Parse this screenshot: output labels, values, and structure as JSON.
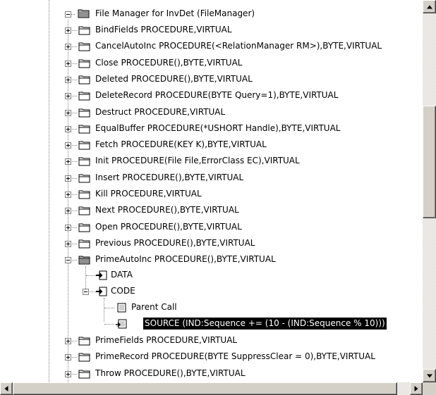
{
  "tree": {
    "root": {
      "label": "File Manager for InvDet (FileManager)",
      "icon": "folder-open-icon"
    },
    "items": [
      {
        "label": "BindFields PROCEDURE,VIRTUAL",
        "state": "collapsed"
      },
      {
        "label": "CancelAutoInc PROCEDURE(<RelationManager RM>),BYTE,VIRTUAL",
        "state": "collapsed"
      },
      {
        "label": "Close PROCEDURE(),BYTE,VIRTUAL",
        "state": "collapsed"
      },
      {
        "label": "Deleted PROCEDURE(),BYTE,VIRTUAL",
        "state": "collapsed"
      },
      {
        "label": "DeleteRecord PROCEDURE(BYTE Query=1),BYTE,VIRTUAL",
        "state": "collapsed"
      },
      {
        "label": "Destruct PROCEDURE,VIRTUAL",
        "state": "collapsed"
      },
      {
        "label": "EqualBuffer PROCEDURE(*USHORT Handle),BYTE,VIRTUAL",
        "state": "collapsed"
      },
      {
        "label": "Fetch PROCEDURE(KEY K),BYTE,VIRTUAL",
        "state": "collapsed"
      },
      {
        "label": "Init PROCEDURE(File File,ErrorClass EC),VIRTUAL",
        "state": "collapsed"
      },
      {
        "label": "Insert PROCEDURE(),BYTE,VIRTUAL",
        "state": "collapsed"
      },
      {
        "label": "Kill PROCEDURE,VIRTUAL",
        "state": "collapsed"
      },
      {
        "label": "Next PROCEDURE(),BYTE,VIRTUAL",
        "state": "collapsed"
      },
      {
        "label": "Open PROCEDURE(),BYTE,VIRTUAL",
        "state": "collapsed"
      },
      {
        "label": "Previous PROCEDURE(),BYTE,VIRTUAL",
        "state": "collapsed"
      },
      {
        "label": "PrimeAutoInc PROCEDURE(),BYTE,VIRTUAL",
        "state": "expanded"
      }
    ],
    "prime_children": {
      "data_label": "DATA",
      "code_label": "CODE",
      "parent_call_label": "Parent Call",
      "source_label": "SOURCE (IND:Sequence += (10 - (IND:Sequence % 10)))"
    },
    "after_items": [
      {
        "label": "PrimeFields PROCEDURE,VIRTUAL",
        "state": "collapsed"
      },
      {
        "label": "PrimeRecord PROCEDURE(BYTE SuppressClear = 0),BYTE,VIRTUAL",
        "state": "collapsed"
      },
      {
        "label": "Throw PROCEDURE(),BYTE,VIRTUAL",
        "state": "collapsed"
      }
    ]
  },
  "colors": {
    "selection_bg": "#000000",
    "selection_fg": "#ffffff",
    "folder_fill": "#ffffff",
    "folder_stroke": "#000000"
  },
  "scroll": {
    "vertical_position_fraction": 0.27,
    "horizontal_position_fraction": 0.0
  }
}
